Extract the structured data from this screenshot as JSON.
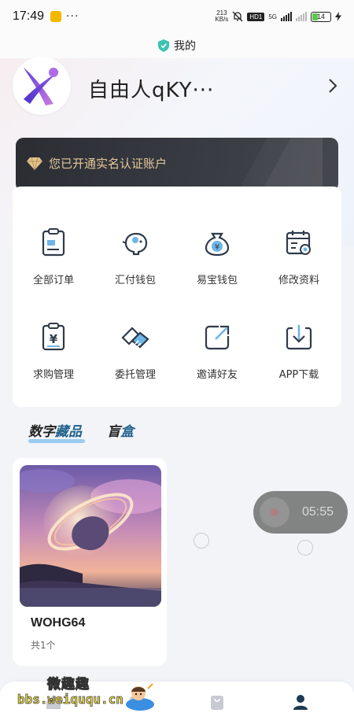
{
  "status_bar": {
    "time": "17:49",
    "dots": "···",
    "net_speed_value": "213",
    "net_speed_unit": "KB/s",
    "hd_label": "HD1",
    "network_label": "5G",
    "battery_level": "14"
  },
  "title_bar": {
    "title": "我的"
  },
  "profile": {
    "username": "自由人qKY···"
  },
  "verify_banner": {
    "label": "您已开通实名认证账户"
  },
  "menu_grid": [
    {
      "label": "全部订单",
      "icon": "order-list-icon"
    },
    {
      "label": "汇付钱包",
      "icon": "piggy-bank-icon"
    },
    {
      "label": "易宝钱包",
      "icon": "money-bag-icon"
    },
    {
      "label": "修改资料",
      "icon": "calendar-settings-icon"
    },
    {
      "label": "求购管理",
      "icon": "purchase-icon"
    },
    {
      "label": "委托管理",
      "icon": "handshake-icon"
    },
    {
      "label": "邀请好友",
      "icon": "share-icon"
    },
    {
      "label": "APP下载",
      "icon": "download-icon"
    }
  ],
  "tabs": {
    "digital_a": "数字",
    "digital_b": "藏品",
    "blind_a": "盲",
    "blind_b": "盒"
  },
  "product": {
    "name": "WOHG64",
    "count": "共1个"
  },
  "floating_timer": {
    "time": "05:55"
  },
  "watermark": {
    "top": "微趣趣",
    "url": "bbs.weiququ.cn"
  },
  "colors": {
    "accent": "#1f5f8b",
    "banner_gold": "#e4c99a",
    "banner_dark": "#2b2d33",
    "icon_stroke": "#2f3a4a"
  }
}
